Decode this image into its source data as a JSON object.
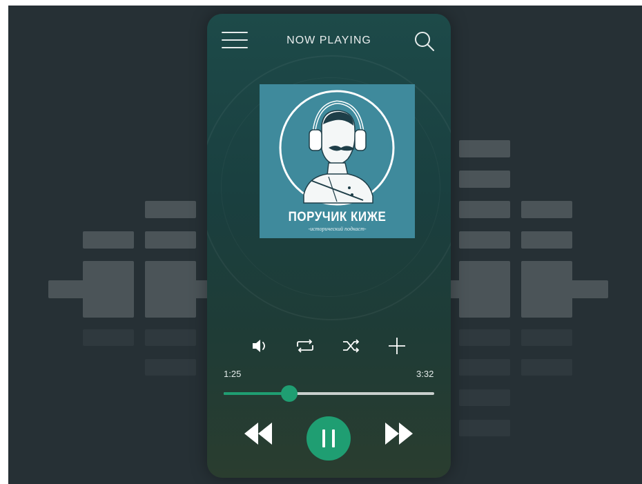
{
  "header": {
    "title": "NOW PLAYING"
  },
  "album": {
    "title": "ПОРУЧИК КИЖЕ",
    "subtitle": "-исторический подкаст-"
  },
  "player": {
    "elapsed": "1:25",
    "duration": "3:32",
    "progress": 0.31
  },
  "colors": {
    "accent": "#1f9e72",
    "background": "#263035",
    "album_bg": "#3f8a9c"
  },
  "icons": {
    "menu": "menu-icon",
    "search": "search-icon",
    "volume": "volume-icon",
    "repeat": "repeat-icon",
    "shuffle": "shuffle-icon",
    "add": "add-icon",
    "rewind": "rewind-icon",
    "pause": "pause-icon",
    "fast_forward": "fast-forward-icon"
  }
}
